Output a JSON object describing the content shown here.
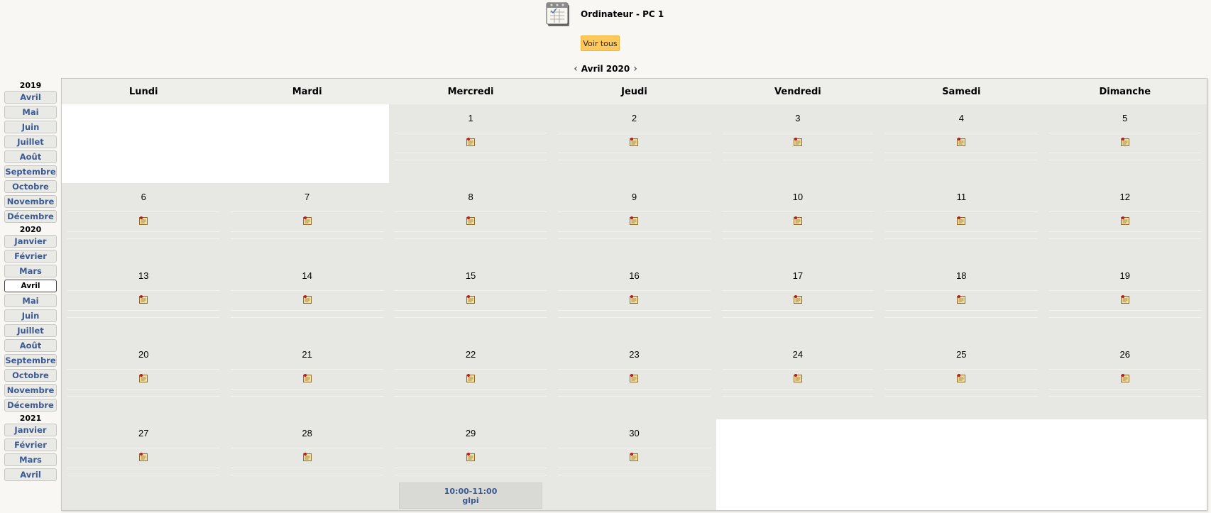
{
  "header": {
    "title": "Ordinateur - PC 1",
    "view_all_label": "Voir tous",
    "prev_icon": "chevron-left-icon",
    "next_icon": "chevron-right-icon",
    "current_month": "Avril 2020"
  },
  "sidebar": {
    "years": [
      {
        "year": "2019",
        "months": [
          "Avril",
          "Mai",
          "Juin",
          "Juillet",
          "Août",
          "Septembre",
          "Octobre",
          "Novembre",
          "Décembre"
        ]
      },
      {
        "year": "2020",
        "months": [
          "Janvier",
          "Février",
          "Mars",
          "Avril",
          "Mai",
          "Juin",
          "Juillet",
          "Août",
          "Septembre",
          "Octobre",
          "Novembre",
          "Décembre"
        ],
        "active_index": 3
      },
      {
        "year": "2021",
        "months": [
          "Janvier",
          "Février",
          "Mars",
          "Avril"
        ]
      }
    ]
  },
  "calendar": {
    "weekdays": [
      "Lundi",
      "Mardi",
      "Mercredi",
      "Jeudi",
      "Vendredi",
      "Samedi",
      "Dimanche"
    ],
    "weeks": [
      [
        "",
        "",
        "1",
        "2",
        "3",
        "4",
        "5"
      ],
      [
        "6",
        "7",
        "8",
        "9",
        "10",
        "11",
        "12"
      ],
      [
        "13",
        "14",
        "15",
        "16",
        "17",
        "18",
        "19"
      ],
      [
        "20",
        "21",
        "22",
        "23",
        "24",
        "25",
        "26"
      ],
      [
        "27",
        "28",
        "29",
        "30",
        "",
        "",
        ""
      ]
    ],
    "add_note_icon": "note-add-icon",
    "event": {
      "day": "29",
      "time": "10:00-11:00",
      "user": "glpi"
    }
  }
}
